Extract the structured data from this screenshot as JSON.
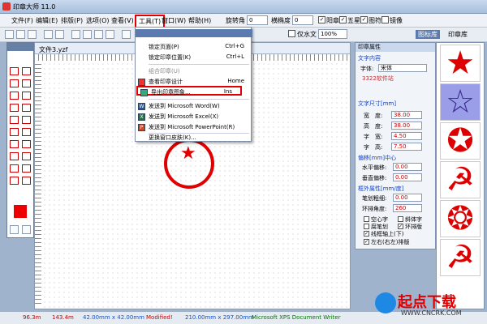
{
  "window": {
    "title": "印章大师 11.0"
  },
  "menubar": {
    "items": [
      "文件(F)",
      "编辑(E)",
      "排版(P)",
      "选项(O)",
      "查看(V)",
      "工具(T)",
      "窗口(W)",
      "帮助(H)"
    ],
    "rotation_label": "旋转角",
    "rotation_value": "0",
    "aspect_label": "横椭度",
    "aspect_value": "0",
    "checks": [
      "阳章",
      "五星",
      "图符",
      "镜像"
    ]
  },
  "toolbar": {
    "inverse_label": "仅水文",
    "zoom": "100%",
    "tab_active": "图标库",
    "tab_other": "印章库"
  },
  "document": {
    "tab": "文件3.yzf"
  },
  "tools_menu": {
    "items": [
      {
        "label": "锁定页面(P)",
        "shortcut": "Ctrl+G",
        "enabled": true
      },
      {
        "label": "锁定印章位置(K)",
        "shortcut": "Ctrl+L",
        "enabled": true
      },
      {
        "label": "组合印章(U)",
        "shortcut": "",
        "enabled": false
      },
      {
        "label": "查看印章设计",
        "shortcut": "Home",
        "enabled": true
      },
      {
        "label": "导出印章图象...",
        "shortcut": "Ins",
        "enabled": true
      },
      {
        "label": "发送到 Microsoft Word(W)",
        "shortcut": "",
        "enabled": true
      },
      {
        "label": "发送到 Microsoft Excel(X)",
        "shortcut": "",
        "enabled": true
      },
      {
        "label": "发送到 Microsoft PowerPoint(R)",
        "shortcut": "",
        "enabled": true
      },
      {
        "label": "更换窗口皮肤(K)...",
        "shortcut": "",
        "enabled": true
      }
    ]
  },
  "props": {
    "title": "印章属性",
    "text_section": "文字内容",
    "font_label": "字体:",
    "font_value": "宋体",
    "content": "3322软件站",
    "size_section": "文字尺寸[mm]",
    "fields": [
      {
        "label": "宽　度:",
        "value": "38.00"
      },
      {
        "label": "高　度:",
        "value": "38.00"
      },
      {
        "label": "字　宽:",
        "value": "4.50"
      },
      {
        "label": "字　高:",
        "value": "7.50"
      }
    ],
    "offset_section": "偏移[mm]中心",
    "hoffset_label": "水平偏移:",
    "hoffset_value": "0.00",
    "voffset_label": "垂直偏移:",
    "voffset_value": "0.00",
    "border_section": "框外属性[mm/度]",
    "stroke_label": "笔划粗细:",
    "stroke_value": "0.00",
    "angle_label": "环排角度:",
    "angle_value": "260",
    "opts": [
      "空心字",
      "斜体字",
      "腐笔划",
      "环排版",
      "线框轴上(下)",
      "左右(右左)排版"
    ]
  },
  "status": {
    "x": "96.3m",
    "y": "143.4m",
    "seal_size": "42.00mm x 42.00mm",
    "modified": "Modified!",
    "paper": "210.00mm x 297.00mm",
    "printer": "Microsoft XPS Document Writer"
  },
  "watermark": {
    "name": "起点下载",
    "url": "WWW.CNCRK.COM"
  },
  "colors": {
    "accent": "#e00000",
    "selection_red": "#e00000"
  }
}
